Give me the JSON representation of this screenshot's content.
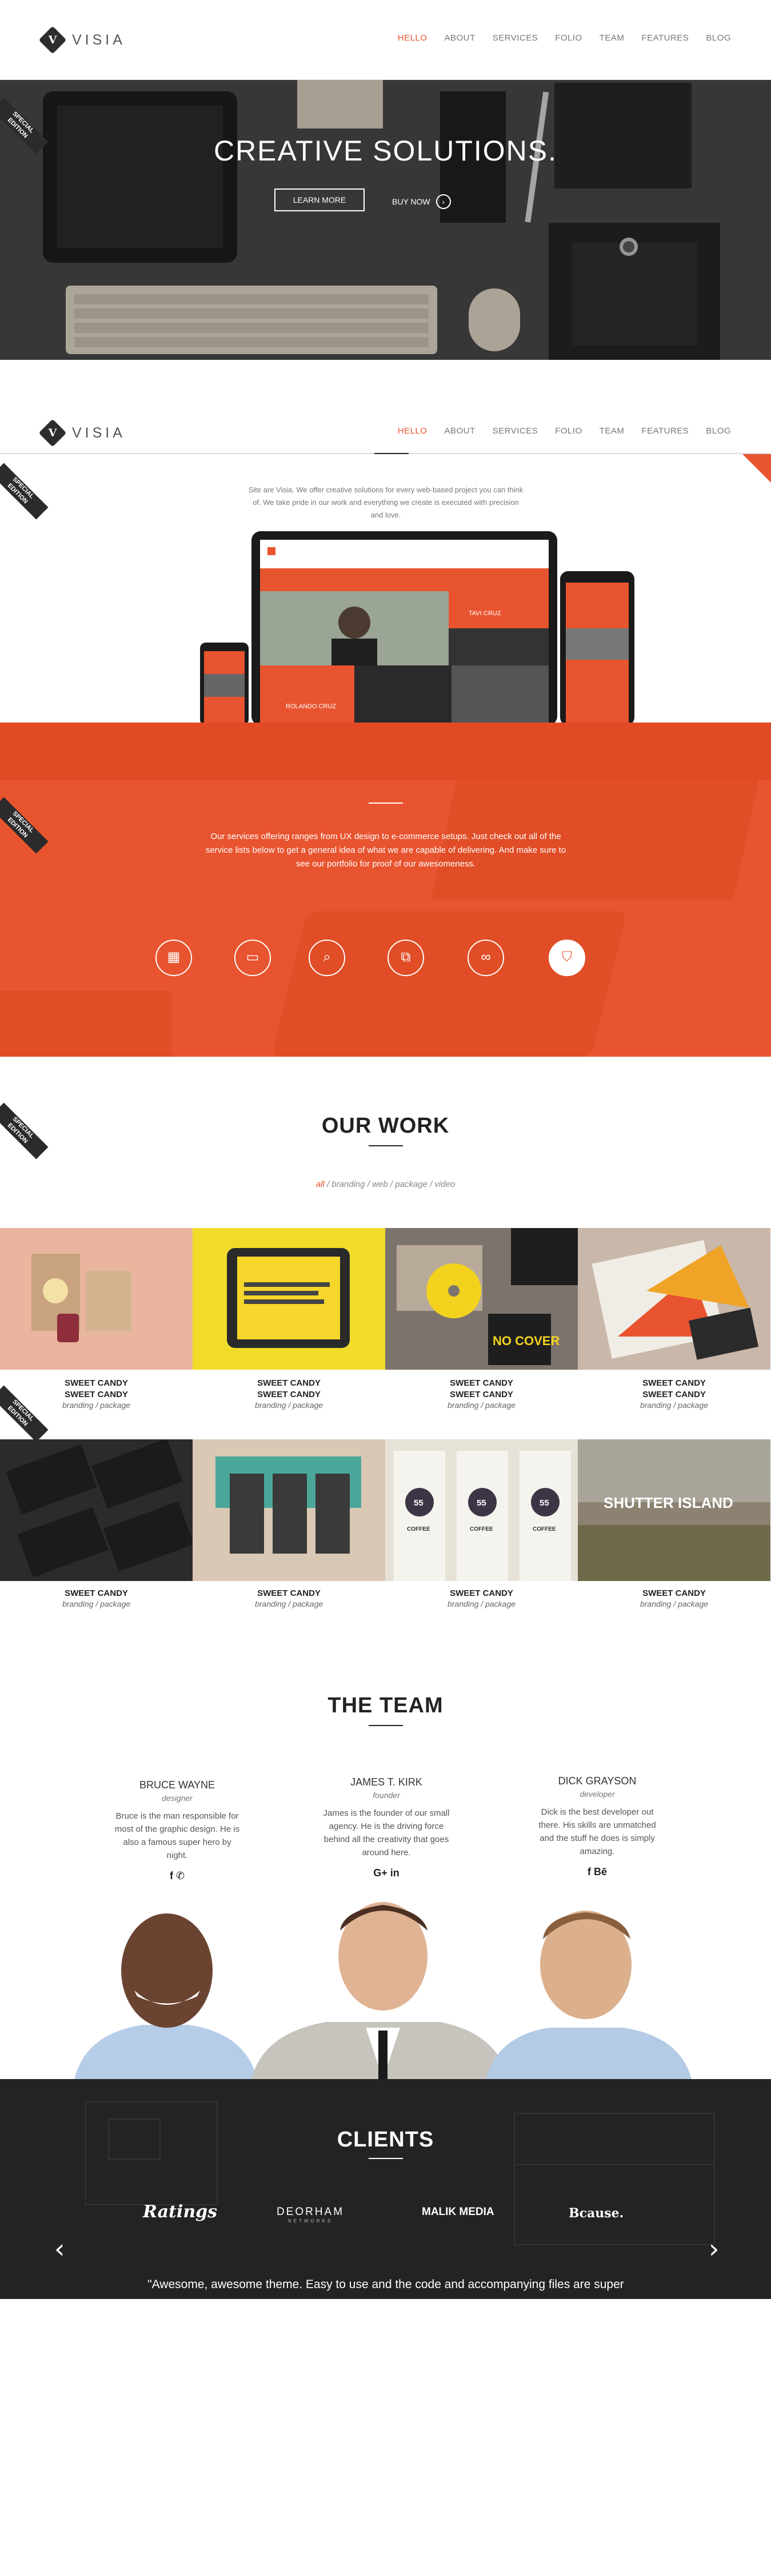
{
  "brand": {
    "name": "VISIA",
    "mark": "V"
  },
  "nav": {
    "items": [
      "HELLO",
      "ABOUT",
      "SERVICES",
      "FOLIO",
      "TEAM",
      "FEATURES",
      "BLOG"
    ],
    "active": 0
  },
  "badge": {
    "line1": "SPECIAL",
    "line2": "EDITION"
  },
  "hero": {
    "title": "CREATIVE SOLUTIONS.",
    "learn_more": "LEARN MORE",
    "buy_now": "BUY NOW"
  },
  "about": {
    "intro": "Site are Visia. We offer creative solutions for every web-based project you can think of. We take pride in our work and everything we create is executed with precision and love.",
    "screen_promo": "TAVI CRUZ",
    "screen_caption": "ROLANDO CRUZ"
  },
  "services": {
    "lead": "Our services offering ranges from UX design to e-commerce setups. Just check out all of the service lists below to get a general idea of what we are capable of delivering. And make sure to see our portfolio for proof of our awesomeness.",
    "icons": [
      "grid-icon",
      "browser-icon",
      "search-icon",
      "windows-icon",
      "glasses-icon",
      "shield-icon"
    ]
  },
  "work": {
    "title": "OUR WORK",
    "filters": [
      {
        "label": "all",
        "active": true
      },
      {
        "label": "branding"
      },
      {
        "label": "web"
      },
      {
        "label": "package"
      },
      {
        "label": "video"
      }
    ],
    "items": [
      {
        "title": "SWEET CANDY",
        "title2": "SWEET CANDY",
        "sub": "branding / package",
        "bg": "#e9b59e"
      },
      {
        "title": "SWEET CANDY",
        "title2": "SWEET CANDY",
        "sub": "branding / package",
        "bg": "#f2dc2b"
      },
      {
        "title": "SWEET CANDY",
        "title2": "SWEET CANDY",
        "sub": "branding / package",
        "bg": "#7c746c"
      },
      {
        "title": "SWEET CANDY",
        "title2": "SWEET CANDY",
        "sub": "branding / package",
        "bg": "#c9b7a9"
      },
      {
        "title": "SWEET CANDY",
        "sub": "branding / package",
        "bg": "#2b2b2b"
      },
      {
        "title": "SWEET CANDY",
        "sub": "branding / package",
        "bg": "#d9c8b4"
      },
      {
        "title": "SWEET CANDY",
        "sub": "branding / package",
        "bg": "#e7e2d7"
      },
      {
        "title": "SWEET CANDY",
        "sub": "branding / package",
        "bg": "#8d8271"
      }
    ],
    "tile_texts": {
      "no_cover": "NO COVER",
      "shutter": "SHUTTER ISLAND",
      "coffee": "COFFEE",
      "fiftyfive": "55"
    }
  },
  "team": {
    "title": "THE TEAM",
    "members": [
      {
        "name": "BRUCE WAYNE",
        "role": "designer",
        "bio": "Bruce is the man responsible for most of the graphic design. He is also a famous super hero by night.",
        "social": "f ✆"
      },
      {
        "name": "JAMES T. KIRK",
        "role": "founder",
        "bio": "James is the founder of our small agency. He is the driving force behind all the creativity that goes around here.",
        "social": "G+ in"
      },
      {
        "name": "DICK GRAYSON",
        "role": "developer",
        "bio": "Dick is the best developer out there. His skills are unmatched and the stuff he does is simply amazing.",
        "social": "f Bē"
      }
    ]
  },
  "clients": {
    "title": "CLIENTS",
    "logos": [
      "Ratings",
      "DEORHAM",
      "MALIK MEDIA",
      "Bcause."
    ],
    "deorham_sub": "NETWORKS",
    "quote": "\"Awesome, awesome theme. Easy to use and the code and accompanying files are super"
  },
  "colors": {
    "accent": "#e8542f",
    "dark": "#2b2b2b"
  }
}
